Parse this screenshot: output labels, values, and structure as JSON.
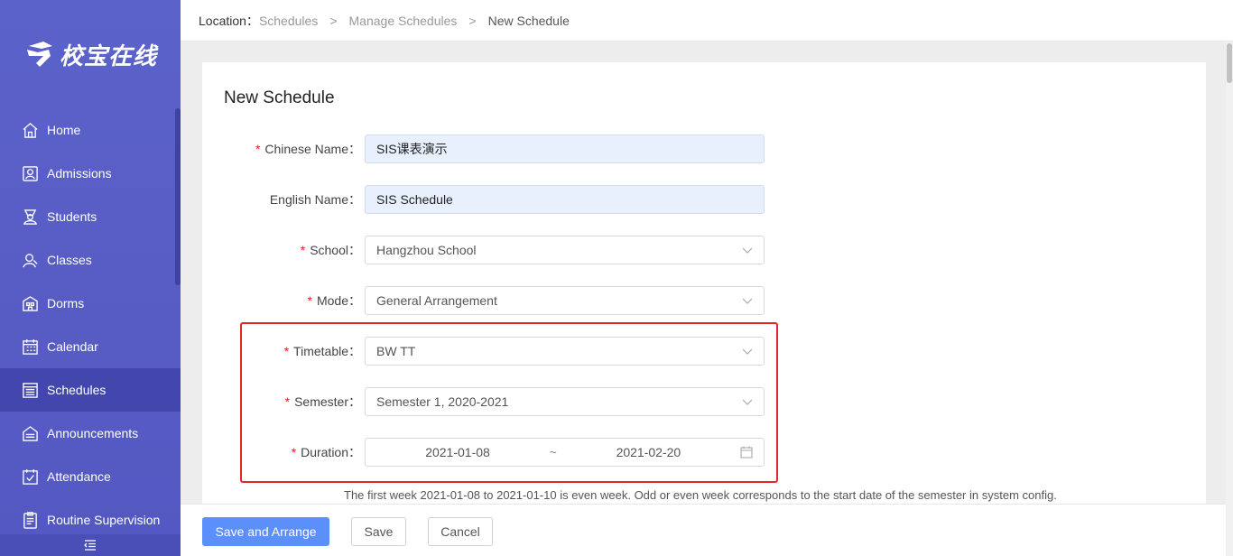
{
  "brand": {
    "name": "校宝在线"
  },
  "sidebar": {
    "items": [
      {
        "label": "Home",
        "icon": "home-icon"
      },
      {
        "label": "Admissions",
        "icon": "admissions-icon"
      },
      {
        "label": "Students",
        "icon": "students-icon"
      },
      {
        "label": "Classes",
        "icon": "classes-icon"
      },
      {
        "label": "Dorms",
        "icon": "dorms-icon"
      },
      {
        "label": "Calendar",
        "icon": "calendar-icon"
      },
      {
        "label": "Schedules",
        "icon": "schedules-icon",
        "active": true
      },
      {
        "label": "Announcements",
        "icon": "announcements-icon"
      },
      {
        "label": "Attendance",
        "icon": "attendance-icon"
      },
      {
        "label": "Routine Supervision",
        "icon": "routine-supervision-icon"
      }
    ],
    "collapse_icon": "collapse-menu-icon"
  },
  "breadcrumb": {
    "label": "Location：",
    "items": [
      "Schedules",
      "Manage Schedules",
      "New Schedule"
    ],
    "separator": ">"
  },
  "form": {
    "title": "New Schedule",
    "chinese_name": {
      "label": "Chinese Name：",
      "value": "SIS课表演示",
      "required": true
    },
    "english_name": {
      "label": "English Name：",
      "value": "SIS Schedule",
      "required": false
    },
    "school": {
      "label": "School：",
      "value": "Hangzhou School",
      "required": true
    },
    "mode": {
      "label": "Mode：",
      "value": "General Arrangement",
      "required": true
    },
    "timetable": {
      "label": "Timetable：",
      "value": "BW TT",
      "required": true
    },
    "semester": {
      "label": "Semester：",
      "value": "Semester 1, 2020-2021",
      "required": true
    },
    "duration": {
      "label": "Duration：",
      "start": "2021-01-08",
      "separator": "~",
      "end": "2021-02-20",
      "required": true
    },
    "required_mark": "*",
    "hint": "The first week 2021-01-08 to 2021-01-10 is even week. Odd or even week corresponds to the start date of the semester in system config."
  },
  "actions": {
    "save_arrange": "Save and Arrange",
    "save": "Save",
    "cancel": "Cancel"
  },
  "colors": {
    "sidebar": "#5b62c9",
    "sidebar_active": "#4347ad",
    "primary": "#5b8ff9",
    "highlight": "#e02828",
    "required": "#e02020"
  }
}
